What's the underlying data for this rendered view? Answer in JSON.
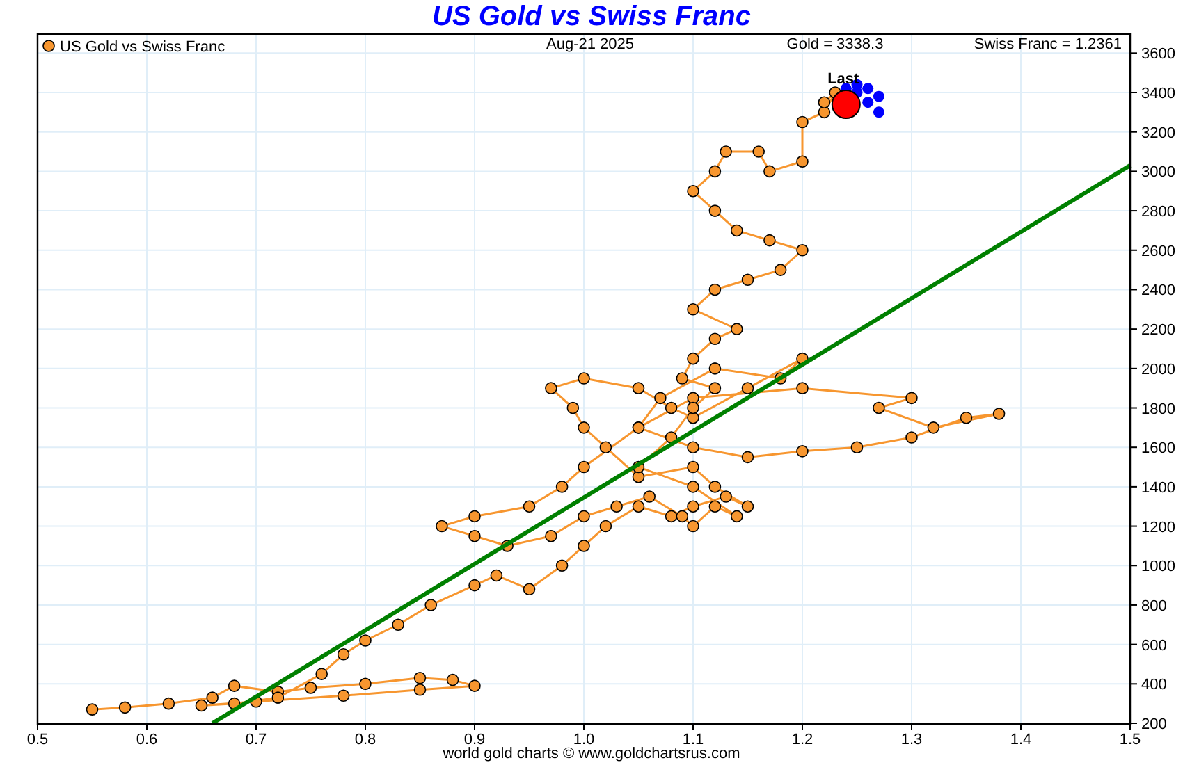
{
  "title": "US Gold vs Swiss Franc",
  "header": {
    "date": "Aug-21  2025",
    "gold": "Gold = 3338.3",
    "franc": "Swiss Franc = 1.2361"
  },
  "chart_data": {
    "type": "scatter",
    "grid": true,
    "xlim": [
      0.5,
      1.5
    ],
    "ylim": [
      200,
      3700
    ],
    "xticks": [
      0.5,
      0.6,
      0.7,
      0.8,
      0.9,
      {
        "value": 1,
        "label": "1.0"
      },
      1.1,
      1.2,
      1.3,
      1.4,
      1.5
    ],
    "yticks": [
      200,
      400,
      600,
      800,
      1000,
      1200,
      1400,
      1600,
      1800,
      2000,
      2200,
      2400,
      2600,
      2800,
      3000,
      3200,
      3400,
      3600
    ],
    "series": [
      {
        "name": "US Gold vs Swiss Franc",
        "type": "line",
        "marker": true,
        "color": "#f7962f",
        "x": [
          0.55,
          0.58,
          0.62,
          0.66,
          0.68,
          0.72,
          0.75,
          0.8,
          0.85,
          0.88,
          0.9,
          0.85,
          0.78,
          0.7,
          0.65,
          0.68,
          0.72,
          0.76,
          0.78,
          0.8,
          0.83,
          0.86,
          0.9,
          0.92,
          0.95,
          0.98,
          1.0,
          1.02,
          1.05,
          1.08,
          1.1,
          1.13,
          1.15,
          1.12,
          1.1,
          1.05,
          1.02,
          1.0,
          0.99,
          0.97,
          1.0,
          1.05,
          1.08,
          1.1,
          1.15,
          1.2,
          1.18,
          1.12,
          1.07,
          1.05,
          1.1,
          1.15,
          1.2,
          1.25,
          1.3,
          1.35,
          1.38,
          1.32,
          1.27,
          1.3,
          1.2,
          1.1,
          1.05,
          1.0,
          0.98,
          0.95,
          0.9,
          0.87,
          0.9,
          0.93,
          0.97,
          1.0,
          1.03,
          1.06,
          1.09,
          1.1,
          1.12,
          1.14,
          1.1,
          1.05,
          1.08,
          1.1,
          1.12,
          1.09,
          1.1,
          1.12,
          1.14,
          1.1,
          1.12,
          1.15,
          1.18,
          1.2,
          1.17,
          1.14,
          1.12,
          1.1,
          1.12,
          1.13,
          1.16,
          1.17,
          1.2,
          1.2,
          1.22,
          1.23,
          1.22
        ],
        "values": [
          270,
          280,
          300,
          330,
          390,
          360,
          380,
          400,
          430,
          420,
          390,
          370,
          340,
          310,
          290,
          300,
          330,
          450,
          550,
          620,
          700,
          800,
          900,
          950,
          880,
          1000,
          1100,
          1200,
          1300,
          1250,
          1300,
          1350,
          1300,
          1400,
          1500,
          1450,
          1600,
          1700,
          1800,
          1900,
          1950,
          1900,
          1800,
          1750,
          1900,
          2050,
          1950,
          2000,
          1850,
          1700,
          1600,
          1550,
          1580,
          1600,
          1650,
          1750,
          1770,
          1700,
          1800,
          1850,
          1900,
          1850,
          1700,
          1500,
          1400,
          1300,
          1250,
          1200,
          1150,
          1100,
          1150,
          1250,
          1300,
          1350,
          1250,
          1200,
          1300,
          1250,
          1400,
          1500,
          1650,
          1800,
          1900,
          1950,
          2050,
          2150,
          2200,
          2300,
          2400,
          2450,
          2500,
          2600,
          2650,
          2700,
          2800,
          2900,
          3000,
          3100,
          3100,
          3000,
          3050,
          3250,
          3300,
          3400,
          3350
        ]
      },
      {
        "type": "scatter",
        "color": "#0000ff",
        "x": [
          1.25,
          1.25,
          1.26,
          1.27,
          1.27,
          1.26,
          1.24
        ],
        "values": [
          3440,
          3400,
          3350,
          3380,
          3300,
          3420,
          3420
        ]
      },
      {
        "type": "scatter",
        "color": "#ff0000",
        "x": [
          1.24
        ],
        "values": [
          3340
        ]
      },
      {
        "type": "line",
        "color": "#008000",
        "x": [
          0.66,
          1.5
        ],
        "values": [
          200,
          3030
        ]
      }
    ],
    "annotations": [
      {
        "text": "Last",
        "x": 1.24,
        "y": 3340
      }
    ]
  },
  "credit": "world gold charts © www.goldchartsrus.com"
}
